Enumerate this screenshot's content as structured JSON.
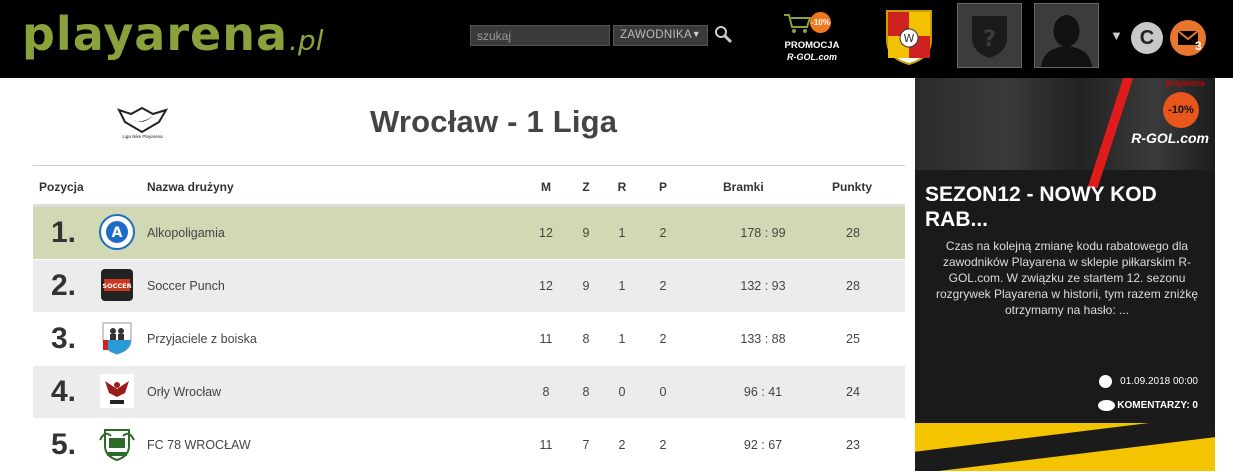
{
  "header": {
    "logo_main": "playarena",
    "logo_tld": ".pl",
    "search_placeholder": "szukaj",
    "search_scope": "ZAWODNIKA",
    "promo_badge": "-10%",
    "promo_title": "PROMOCJA",
    "promo_brand": "R-GOL.com",
    "coin_label": "C",
    "mail_count": "3"
  },
  "league": {
    "logo_caption": "Liga Nike Playarena",
    "title": "Wrocław - 1 Liga"
  },
  "table": {
    "columns": {
      "pos": "Pozycja",
      "team": "Nazwa drużyny",
      "m": "M",
      "z": "Z",
      "r": "R",
      "p": "P",
      "goals": "Bramki",
      "points": "Punkty"
    },
    "rows": [
      {
        "pos": "1.",
        "team": "Alkopoligamia",
        "m": "12",
        "z": "9",
        "r": "1",
        "p": "2",
        "goals": "178 : 99",
        "points": "28"
      },
      {
        "pos": "2.",
        "team": "Soccer Punch",
        "m": "12",
        "z": "9",
        "r": "1",
        "p": "2",
        "goals": "132 : 93",
        "points": "28"
      },
      {
        "pos": "3.",
        "team": "Przyjaciele z boiska",
        "m": "11",
        "z": "8",
        "r": "1",
        "p": "2",
        "goals": "133 : 88",
        "points": "25"
      },
      {
        "pos": "4.",
        "team": "Orły Wrocław",
        "m": "8",
        "z": "8",
        "r": "0",
        "p": "0",
        "goals": "96 : 41",
        "points": "24"
      },
      {
        "pos": "5.",
        "team": "FC 78 WROCŁAW",
        "m": "11",
        "z": "7",
        "r": "2",
        "p": "2",
        "goals": "92 : 67",
        "points": "23"
      }
    ]
  },
  "sidebar": {
    "ad_top": "playarena",
    "ad_badge": "-10%",
    "ad_brand": "R-GOL.com",
    "headline": "SEZON12 - NOWY KOD RAB...",
    "body": "Czas na kolejną zmianę kodu rabatowego dla zawodników Playarena w sklepie piłkarskim R-GOL.com. W związku ze startem 12. sezonu rozgrywek Playarena w historii, tym razem zniżkę otrzymamy na hasło: ...",
    "date": "01.09.2018 00:00",
    "comments": "KOMENTARZY: 0"
  },
  "colors": {
    "brand_green": "#8aa23c",
    "leader_row": "#d0d8b4",
    "promo_orange": "#f0781e",
    "mail_orange": "#e8762c",
    "ad_yellow": "#f5c400"
  }
}
